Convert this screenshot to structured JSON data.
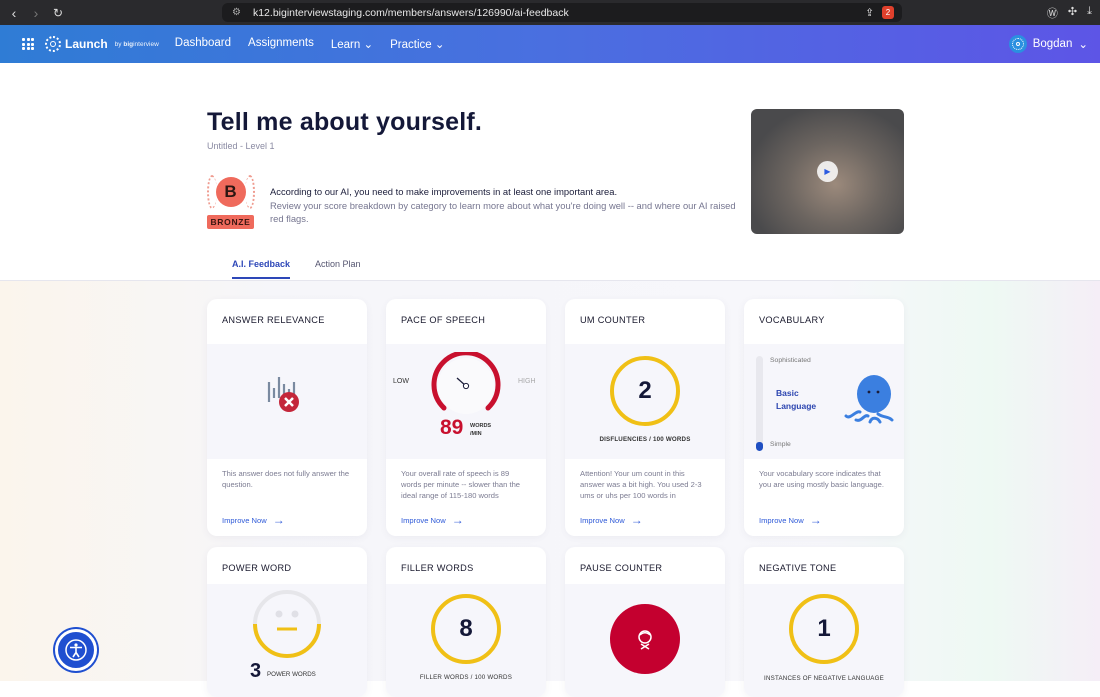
{
  "browser": {
    "url": "k12.biginterviewstaging.com/members/answers/126990/ai-feedback",
    "shield_count": "2"
  },
  "nav": {
    "brand": "Launch",
    "by": "by",
    "brand_sub_bold": "big",
    "brand_sub": "interview",
    "items": [
      {
        "label": "Dashboard"
      },
      {
        "label": "Assignments"
      },
      {
        "label": "Learn"
      },
      {
        "label": "Practice"
      }
    ],
    "user": "Bogdan"
  },
  "hero": {
    "title": "Tell me about yourself.",
    "subtitle": "Untitled - Level 1",
    "grade": "B",
    "grade_label": "BRONZE",
    "message_title": "According to our AI, you need to make improvements in at least one important area.",
    "message_body": "Review your score breakdown by category to learn more about what you're doing well -- and where our AI raised red flags."
  },
  "tabs": [
    {
      "label": "A.I. Feedback",
      "active": true
    },
    {
      "label": "Action Plan",
      "active": false
    }
  ],
  "cards": {
    "relevance": {
      "title": "ANSWER RELEVANCE",
      "text": "This answer does not fully answer the question.",
      "link": "Improve Now"
    },
    "pace": {
      "title": "PACE OF SPEECH",
      "low": "LOW",
      "high": "HIGH",
      "value": "89",
      "unit1": "WORDS",
      "unit2": "/MIN",
      "text": "Your overall rate of speech is 89 words per minute -- slower than the ideal range of 115-180 words",
      "link": "Improve Now"
    },
    "um": {
      "title": "UM COUNTER",
      "value": "2",
      "caption": "DISFLUENCIES / 100 WORDS",
      "text": "Attention! Your um count in this answer was a bit high. You used 2-3 ums or uhs per 100 words in",
      "link": "Improve Now"
    },
    "vocab": {
      "title": "VOCABULARY",
      "top": "Sophisticated",
      "bottom": "Simple",
      "level1": "Basic",
      "level2": "Language",
      "level_fraction": 0.1,
      "text": "Your vocabulary score indicates that you are using mostly basic language.",
      "link": "Improve Now"
    },
    "power": {
      "title": "POWER WORD",
      "value": "3",
      "caption": "POWER WORDS"
    },
    "filler": {
      "title": "FILLER WORDS",
      "value": "8",
      "caption": "FILLER WORDS / 100 WORDS"
    },
    "pause": {
      "title": "PAUSE COUNTER"
    },
    "negative": {
      "title": "NEGATIVE TONE",
      "value": "1",
      "caption": "INSTANCES OF NEGATIVE LANGUAGE"
    }
  },
  "colors": {
    "accent": "#2f5ad8",
    "ring": "#f0c016",
    "red": "#c4002f",
    "bronze": "#ef6a5c"
  }
}
